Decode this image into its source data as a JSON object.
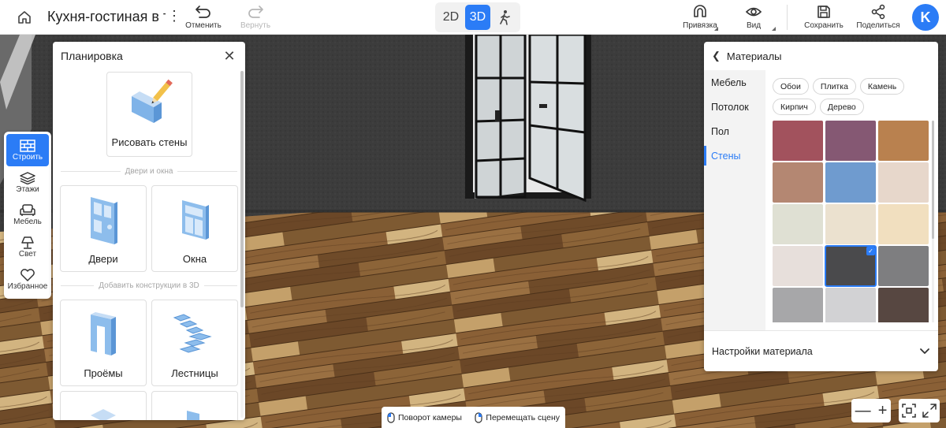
{
  "app": {
    "project_title": "Кухня-гостиная в тем",
    "avatar_letter": "K"
  },
  "toolbar": {
    "undo_label": "Отменить",
    "redo_label": "Вернуть",
    "mode_2d": "2D",
    "mode_3d": "3D",
    "active_mode": "3D",
    "snap_label": "Привязка",
    "view_label": "Вид",
    "save_label": "Сохранить",
    "share_label": "Поделиться"
  },
  "left_tools": [
    {
      "label": "Строить",
      "icon": "brick-wall-icon",
      "active": true
    },
    {
      "label": "Этажи",
      "icon": "layers-icon",
      "active": false
    },
    {
      "label": "Мебель",
      "icon": "sofa-icon",
      "active": false
    },
    {
      "label": "Свет",
      "icon": "lamp-icon",
      "active": false
    },
    {
      "label": "Избранное",
      "icon": "heart-icon",
      "active": false
    }
  ],
  "planning": {
    "title": "Планировка",
    "draw_walls": "Рисовать стены",
    "section_doors": "Двери и окна",
    "doors": "Двери",
    "windows": "Окна",
    "section_constructions": "Добавить конструкции в 3D",
    "openings": "Проёмы",
    "stairs": "Лестницы"
  },
  "materials": {
    "title": "Материалы",
    "categories": [
      {
        "label": "Мебель",
        "active": false
      },
      {
        "label": "Потолок",
        "active": false
      },
      {
        "label": "Пол",
        "active": false
      },
      {
        "label": "Стены",
        "active": true
      }
    ],
    "chips": [
      "Обои",
      "Плитка",
      "Камень",
      "Кирпич",
      "Дерево"
    ],
    "swatches": [
      "#a2525d",
      "#855873",
      "#b9814f",
      "#b48772",
      "#6f9bcf",
      "#e7d7cb",
      "#dfe0d3",
      "#ebe1cf",
      "#f1dfbf",
      "#e7dfdb",
      "#4a4a4c",
      "#7e7e80",
      "#a7a7a9",
      "#d2d2d4",
      "#574741"
    ],
    "selected_index": 10,
    "settings_label": "Настройки материала"
  },
  "hints": {
    "rotate": "Поворот камеры",
    "move": "Перемещать сцену"
  },
  "colors": {
    "accent": "#2b7cf6"
  }
}
